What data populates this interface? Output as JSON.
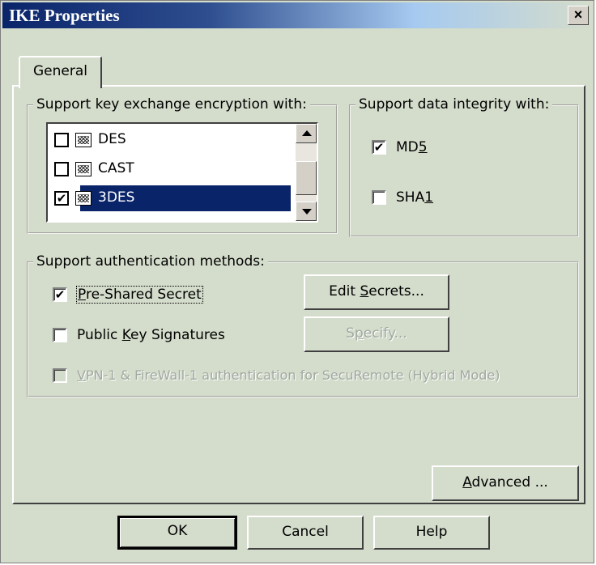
{
  "window": {
    "title": "IKE Properties",
    "close_label": "×"
  },
  "tabs": [
    {
      "label": "General"
    }
  ],
  "encryption_group": {
    "legend": "Support key exchange encryption with:",
    "items": [
      {
        "label": "DES",
        "checked": false,
        "selected": false
      },
      {
        "label": "CAST",
        "checked": false,
        "selected": false
      },
      {
        "label": "3DES",
        "checked": true,
        "selected": true
      }
    ]
  },
  "integrity_group": {
    "legend": "Support data integrity with:",
    "items": [
      {
        "label_pre": "MD",
        "label_key": "5",
        "label_post": "",
        "checked": true
      },
      {
        "label_pre": "SHA",
        "label_key": "1",
        "label_post": "",
        "checked": false
      }
    ]
  },
  "auth_group": {
    "legend": "Support authentication methods:",
    "pre_shared": {
      "label_pre": "",
      "label_key": "P",
      "label_post": "re-Shared Secret",
      "checked": true
    },
    "public_key": {
      "label_pre": "Public ",
      "label_key": "K",
      "label_post": "ey Signatures",
      "checked": false
    },
    "hybrid": {
      "label_pre": "",
      "label_key": "V",
      "label_post": "PN-1 & FireWall-1 authentication for SecuRemote (Hybrid Mode)",
      "checked": false,
      "disabled": true
    },
    "edit_secrets": {
      "label_pre": "Edit ",
      "label_key": "S",
      "label_post": "ecrets..."
    },
    "specify": {
      "label_pre": "S",
      "label_key": "p",
      "label_post": "ecify...",
      "disabled": true
    }
  },
  "advanced_button": {
    "label_pre": "",
    "label_key": "A",
    "label_post": "dvanced ..."
  },
  "footer": {
    "ok": "OK",
    "cancel": "Cancel",
    "help": "Help"
  },
  "check_glyph": "✔"
}
